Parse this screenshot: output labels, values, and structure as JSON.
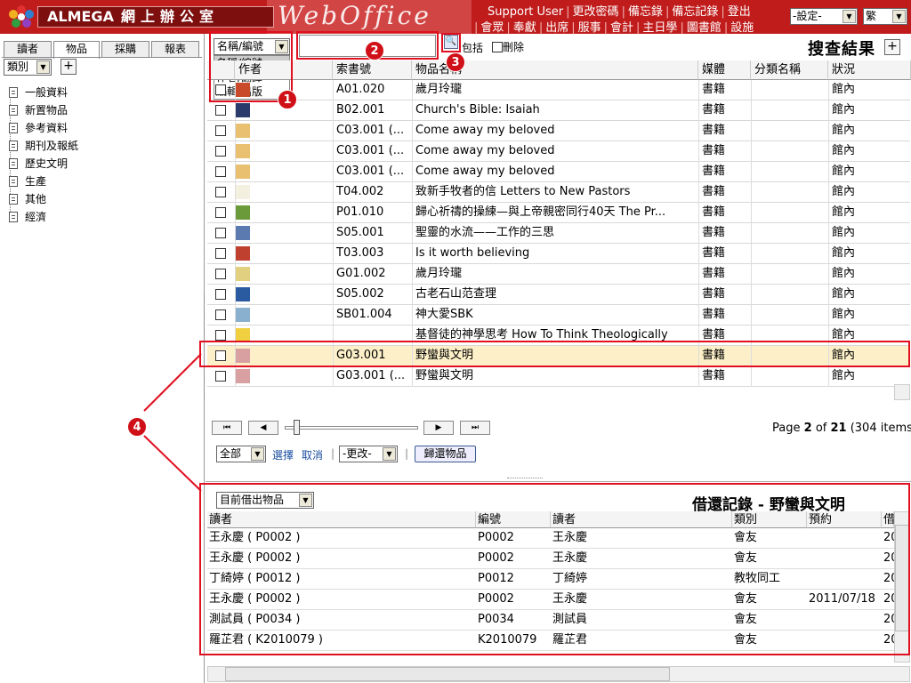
{
  "header": {
    "brand": "ALMEGA",
    "brand_zh": "網上辦公室",
    "product": "WebOffice",
    "user": "Support User",
    "links_row1": [
      "更改密碼",
      "備忘錄",
      "備忘記錄",
      "登出"
    ],
    "links_row2": [
      "會眾",
      "奉獻",
      "出席",
      "服事",
      "會計",
      "主日學",
      "圖書館",
      "設施"
    ],
    "settings_select": "-設定-",
    "lang_select": "繁"
  },
  "left": {
    "tabs": [
      "讀者",
      "物品",
      "採購",
      "報表"
    ],
    "active_tab": "物品",
    "category_select": "類別",
    "add_label": "+",
    "tree": [
      "一般資料",
      "新置物品",
      "參考資料",
      "期刊及報紙",
      "歷史文明",
      "生產",
      "其他",
      "經濟"
    ]
  },
  "search": {
    "field_select": "名稱/編號",
    "field_options": [
      "名稱/編號",
      "作者/翻譯",
      "編輯/出版"
    ],
    "query": "",
    "include_label": "包括",
    "delete_label": "刪除",
    "results_title": "搜查結果",
    "add_label": "+"
  },
  "table": {
    "columns": [
      "作者",
      "索書號",
      "物品名稱",
      "媒體",
      "分類名稱",
      "狀況"
    ],
    "rows": [
      {
        "call_no": "A01.020",
        "title": "歲月玲瓏",
        "media": "書籍",
        "category": "",
        "status": "館內",
        "thumb": "#c84a2a"
      },
      {
        "call_no": "B02.001",
        "title": "Church's Bible: Isaiah",
        "media": "書籍",
        "category": "",
        "status": "館內",
        "thumb": "#2a3a6a"
      },
      {
        "call_no": "C03.001 (...",
        "title": "Come away my beloved",
        "media": "書籍",
        "category": "",
        "status": "館內",
        "thumb": "#e8c070"
      },
      {
        "call_no": "C03.001 (...",
        "title": "Come away my beloved",
        "media": "書籍",
        "category": "",
        "status": "館內",
        "thumb": "#e8c070"
      },
      {
        "call_no": "C03.001 (...",
        "title": "Come away my beloved",
        "media": "書籍",
        "category": "",
        "status": "館內",
        "thumb": "#e8c070"
      },
      {
        "call_no": "T04.002",
        "title": "致新手牧者的信 Letters to New Pastors",
        "media": "書籍",
        "category": "",
        "status": "館內",
        "thumb": "#f4f0e0"
      },
      {
        "call_no": "P01.010",
        "title": "歸心祈禱的操練—與上帝親密同行40天 The Pr...",
        "media": "書籍",
        "category": "",
        "status": "館內",
        "thumb": "#6a9a3a"
      },
      {
        "call_no": "S05.001",
        "title": "聖靈的水流——工作的三思",
        "media": "書籍",
        "category": "",
        "status": "館內",
        "thumb": "#5a7ab0"
      },
      {
        "call_no": "T03.003",
        "title": "Is it worth believing",
        "media": "書籍",
        "category": "",
        "status": "館內",
        "thumb": "#c04030"
      },
      {
        "call_no": "G01.002",
        "title": "歲月玲瓏",
        "media": "書籍",
        "category": "",
        "status": "館內",
        "thumb": "#e0d080"
      },
      {
        "call_no": "S05.002",
        "title": "古老石山范查理",
        "media": "書籍",
        "category": "",
        "status": "館內",
        "thumb": "#2a5aa0"
      },
      {
        "call_no": "SB01.004",
        "title": "神大愛SBK",
        "media": "書籍",
        "category": "",
        "status": "館內",
        "thumb": "#8ab0d0"
      },
      {
        "call_no": "",
        "title": "基督徒的神學思考 How To Think Theologically",
        "media": "書籍",
        "category": "",
        "status": "館內",
        "thumb": "#f0d040"
      },
      {
        "call_no": "G03.001",
        "title": "野蠻與文明",
        "media": "書籍",
        "category": "",
        "status": "館內",
        "thumb": "#d8a0a0"
      },
      {
        "call_no": "G03.001 (...",
        "title": "野蠻與文明",
        "media": "書籍",
        "category": "",
        "status": "館內",
        "thumb": "#d8a0a0"
      }
    ]
  },
  "pagination": {
    "page": "2",
    "total_pages": "21",
    "items": "(304 items)",
    "page_prefix": "Page",
    "of": "of",
    "first": "⏮",
    "prev": "◀",
    "next": "▶",
    "last": "⏭"
  },
  "actions": {
    "scope_select": "全部",
    "select_label": "選擇",
    "cancel_label": "取消",
    "change_select": "-更改-",
    "return_button": "歸還物品"
  },
  "loans": {
    "filter_select": "目前借出物品",
    "title": "借還記錄 - 野蠻與文明",
    "columns": [
      "讀者",
      "編號",
      "讀者",
      "類別",
      "預約",
      "借"
    ],
    "rows": [
      {
        "reader": "王永慶 ( P0002 )",
        "id": "P0002",
        "name": "王永慶",
        "type": "會友",
        "reserve": "",
        "date": "20"
      },
      {
        "reader": "王永慶 ( P0002 )",
        "id": "P0002",
        "name": "王永慶",
        "type": "會友",
        "reserve": "",
        "date": "20"
      },
      {
        "reader": "丁綺婷 ( P0012 )",
        "id": "P0012",
        "name": "丁綺婷",
        "type": "教牧同工",
        "reserve": "",
        "date": "20"
      },
      {
        "reader": "王永慶 ( P0002 )",
        "id": "P0002",
        "name": "王永慶",
        "type": "會友",
        "reserve": "2011/07/18",
        "date": "20"
      },
      {
        "reader": "測試員 ( P0034 )",
        "id": "P0034",
        "name": "測試員",
        "type": "會友",
        "reserve": "",
        "date": "20"
      },
      {
        "reader": "羅芷君 ( K2010079 )",
        "id": "K2010079",
        "name": "羅芷君",
        "type": "會友",
        "reserve": "",
        "date": "20"
      }
    ]
  },
  "annotations": [
    "1",
    "2",
    "3",
    "4"
  ]
}
